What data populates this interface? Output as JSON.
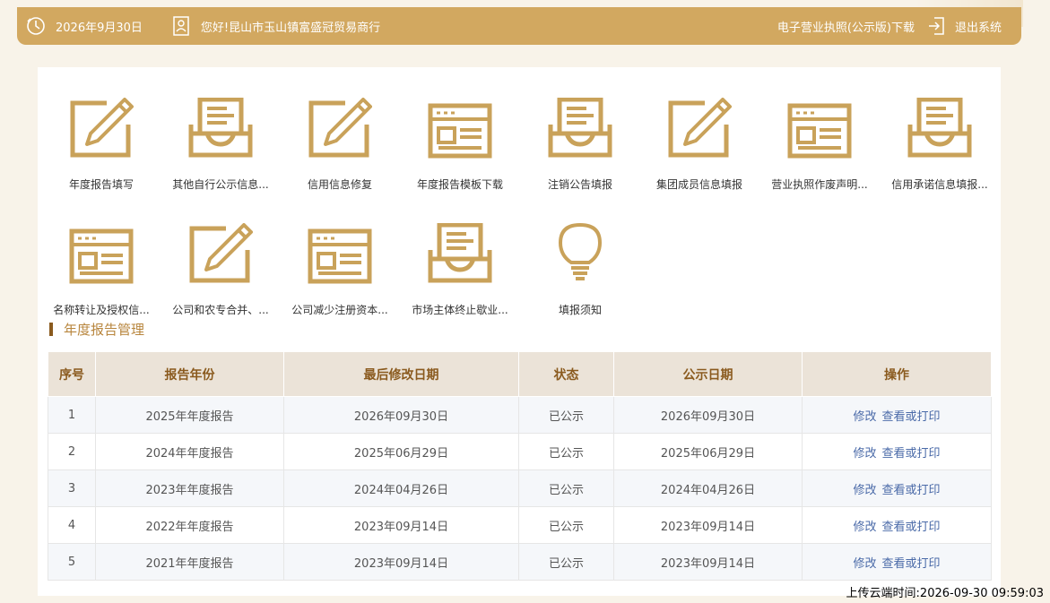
{
  "header": {
    "date": "2026年9月30日",
    "greeting": "您好!昆山市玉山镇富盛冠贸易商行",
    "license_download": "电子营业执照(公示版)下载",
    "logout": "退出系统"
  },
  "icons": [
    {
      "label": "年度报告填写",
      "icon": "edit-pencil-icon"
    },
    {
      "label": "其他自行公示信息...",
      "icon": "inbox-tray-icon"
    },
    {
      "label": "信用信息修复",
      "icon": "edit-pencil-icon"
    },
    {
      "label": "年度报告模板下载",
      "icon": "form-window-icon"
    },
    {
      "label": "注销公告填报",
      "icon": "inbox-tray-icon"
    },
    {
      "label": "集团成员信息填报",
      "icon": "edit-pencil-icon"
    },
    {
      "label": "营业执照作废声明...",
      "icon": "form-window-icon"
    },
    {
      "label": "信用承诺信息填报...",
      "icon": "inbox-tray-icon"
    },
    {
      "label": "名称转让及授权信...",
      "icon": "form-window-icon"
    },
    {
      "label": "公司和农专合并、...",
      "icon": "edit-pencil-icon"
    },
    {
      "label": "公司减少注册资本...",
      "icon": "form-window-icon"
    },
    {
      "label": "市场主体终止歇业...",
      "icon": "inbox-tray-icon"
    },
    {
      "label": "填报须知",
      "icon": "lightbulb-icon"
    }
  ],
  "section": {
    "title": "年度报告管理"
  },
  "table": {
    "headers": [
      "序号",
      "报告年份",
      "最后修改日期",
      "状态",
      "公示日期",
      "操作"
    ],
    "rows": [
      {
        "no": "1",
        "year": "2025年年度报告",
        "modified": "2026年09月30日",
        "status": "已公示",
        "published": "2026年09月30日"
      },
      {
        "no": "2",
        "year": "2024年年度报告",
        "modified": "2025年06月29日",
        "status": "已公示",
        "published": "2025年06月29日"
      },
      {
        "no": "3",
        "year": "2023年年度报告",
        "modified": "2024年04月26日",
        "status": "已公示",
        "published": "2024年04月26日"
      },
      {
        "no": "4",
        "year": "2022年年度报告",
        "modified": "2023年09月14日",
        "status": "已公示",
        "published": "2023年09月14日"
      },
      {
        "no": "5",
        "year": "2021年年度报告",
        "modified": "2023年09月14日",
        "status": "已公示",
        "published": "2023年09月14日"
      }
    ],
    "action_edit": "修改",
    "action_view": "查看或打印"
  },
  "footer": {
    "upload_time": "上传云端时间:2026-09-30 09:59:03"
  },
  "colors": {
    "accent": "#d2a860",
    "icon": "#c9a25a",
    "heading": "#8a5a1e",
    "link": "#4a6aa8"
  }
}
